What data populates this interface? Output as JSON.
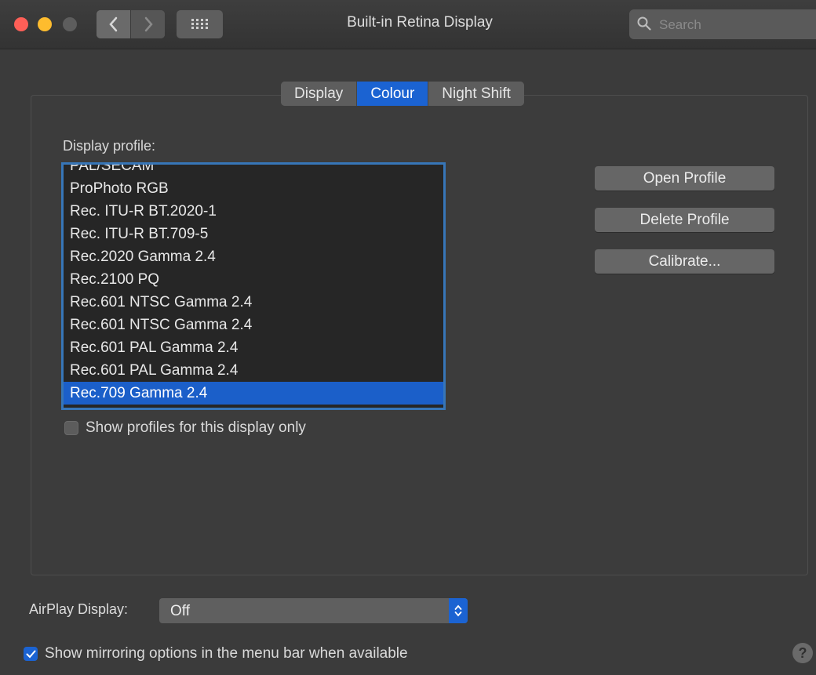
{
  "window": {
    "title": "Built-in Retina Display"
  },
  "search": {
    "placeholder": "Search",
    "value": ""
  },
  "tabs": [
    {
      "label": "Display",
      "active": false
    },
    {
      "label": "Colour",
      "active": true
    },
    {
      "label": "Night Shift",
      "active": false
    }
  ],
  "display_profile": {
    "label": "Display profile:",
    "items": [
      "PAL/SECAM",
      "ProPhoto RGB",
      "Rec. ITU-R BT.2020-1",
      "Rec. ITU-R BT.709-5",
      "Rec.2020 Gamma 2.4",
      "Rec.2100 PQ",
      "Rec.601 NTSC Gamma 2.4",
      "Rec.601 NTSC Gamma 2.4",
      "Rec.601 PAL Gamma 2.4",
      "Rec.601 PAL Gamma 2.4",
      "Rec.709 Gamma 2.4"
    ],
    "selected": "Rec.709 Gamma 2.4"
  },
  "show_profiles": {
    "label": "Show profiles for this display only",
    "checked": false
  },
  "buttons": {
    "open_profile": "Open Profile",
    "delete_profile": "Delete Profile",
    "calibrate": "Calibrate..."
  },
  "airplay": {
    "label": "AirPlay Display:",
    "value": "Off"
  },
  "mirroring": {
    "label": "Show mirroring options in the menu bar when available",
    "checked": true
  },
  "help": {
    "label": "?"
  },
  "colors": {
    "accent": "#1b63d2",
    "background": "#3b3b3b",
    "list_background": "#262626"
  },
  "icons": [
    "back-icon",
    "forward-icon",
    "grid-icon",
    "search-icon",
    "stepper-icon",
    "checkmark-icon",
    "help-icon"
  ]
}
